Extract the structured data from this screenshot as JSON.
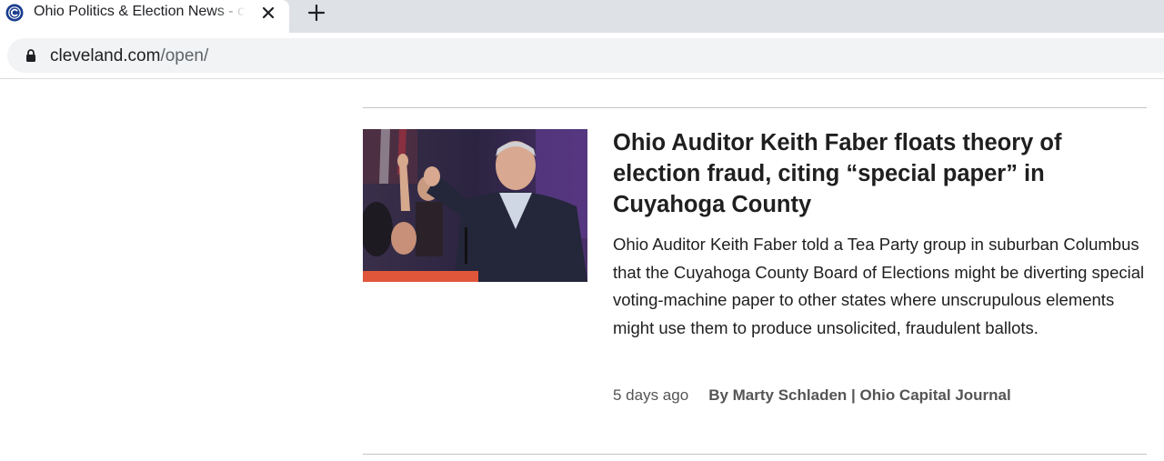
{
  "browser": {
    "tab": {
      "title": "Ohio Politics & Election News - cleveland.com",
      "favicon": "cleveland-c-logo-icon",
      "close_icon": "close-icon"
    },
    "new_tab_icon": "plus-icon",
    "address_bar": {
      "lock_icon": "lock-icon",
      "url_host": "cleveland.com",
      "url_path": "/open/"
    }
  },
  "article": {
    "image_alt": "photo-of-speaker-at-podium",
    "headline": "Ohio Auditor Keith Faber floats theory of election fraud, citing “special paper” in Cuyahoga County",
    "summary": "Ohio Auditor Keith Faber told a Tea Party group in suburban Columbus that the Cuyahoga County Board of Elections might be diverting special voting-machine paper to other states where unscrupulous elements might use them to produce unsolicited, fraudulent ballots.",
    "timestamp": "5 days ago",
    "byline": "By Marty Schladen | Ohio Capital Journal"
  },
  "colors": {
    "tabstrip_bg": "#dee1e6",
    "omnibox_bg": "#f1f3f4",
    "favicon_blue": "#1a3d8f",
    "byline_gray": "#555555"
  }
}
